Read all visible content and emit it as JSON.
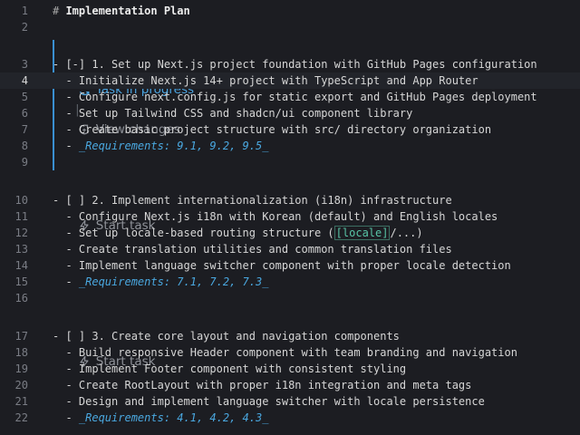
{
  "lines": [
    {
      "n": "1",
      "parts": [
        {
          "t": "# ",
          "c": "hash"
        },
        {
          "t": "Implementation Plan",
          "c": "heading"
        }
      ]
    },
    {
      "n": "2",
      "parts": []
    },
    {
      "n": "3",
      "parts": [
        {
          "t": "- [-] 1. Set up Next.js project foundation with GitHub Pages configuration"
        }
      ]
    },
    {
      "n": "4",
      "parts": [
        {
          "t": "  - Initialize Next.js 14+ project with TypeScript and App Router"
        }
      ]
    },
    {
      "n": "5",
      "parts": [
        {
          "t": "  - Configure next.config.js for static export and GitHub Pages deployment"
        }
      ]
    },
    {
      "n": "6",
      "parts": [
        {
          "t": "  - Set up Tailwind CSS and shadcn/ui component library"
        }
      ]
    },
    {
      "n": "7",
      "parts": [
        {
          "t": "  - Create basic project structure with src/ directory organization"
        }
      ]
    },
    {
      "n": "8",
      "parts": [
        {
          "t": "  - "
        },
        {
          "t": "_Requirements: 9.1, 9.2, 9.5_",
          "c": "req"
        }
      ]
    },
    {
      "n": "9",
      "parts": []
    },
    {
      "n": "10",
      "parts": [
        {
          "t": "- [ ] 2. Implement internationalization (i18n) infrastructure"
        }
      ]
    },
    {
      "n": "11",
      "parts": [
        {
          "t": "  - Configure Next.js i18n with Korean (default) and English locales"
        }
      ]
    },
    {
      "n": "12",
      "parts": [
        {
          "t": "  - Set up locale-based routing structure ("
        },
        {
          "t": "[locale]",
          "c": "loc"
        },
        {
          "t": "/...)"
        }
      ]
    },
    {
      "n": "13",
      "parts": [
        {
          "t": "  - Create translation utilities and common translation files"
        }
      ]
    },
    {
      "n": "14",
      "parts": [
        {
          "t": "  - Implement language switcher component with proper locale detection"
        }
      ]
    },
    {
      "n": "15",
      "parts": [
        {
          "t": "  - "
        },
        {
          "t": "_Requirements: 7.1, 7.2, 7.3_",
          "c": "req"
        }
      ]
    },
    {
      "n": "16",
      "parts": []
    },
    {
      "n": "17",
      "parts": [
        {
          "t": "- [ ] 3. Create core layout and navigation components"
        }
      ]
    },
    {
      "n": "18",
      "parts": [
        {
          "t": "  - Build responsive Header component with team branding and navigation"
        }
      ]
    },
    {
      "n": "19",
      "parts": [
        {
          "t": "  - Implement Footer component with consistent styling"
        }
      ]
    },
    {
      "n": "20",
      "parts": [
        {
          "t": "  - Create RootLayout with proper i18n integration and meta tags"
        }
      ]
    },
    {
      "n": "21",
      "parts": [
        {
          "t": "  - Design and implement language switcher with locale persistence"
        }
      ]
    },
    {
      "n": "22",
      "parts": [
        {
          "t": "  - "
        },
        {
          "t": "_Requirements: 4.1, 4.2, 4.3_",
          "c": "req"
        }
      ]
    }
  ],
  "lenses": {
    "task1_status": "Task in progress",
    "task1_separator": "|",
    "task1_view_changes": "View changes",
    "task2_action": "Start task",
    "task3_action": "Start task"
  },
  "colors": {
    "accent": "#3a8fd1",
    "background": "#1c1d22",
    "requirements": "#4aa8e0"
  }
}
